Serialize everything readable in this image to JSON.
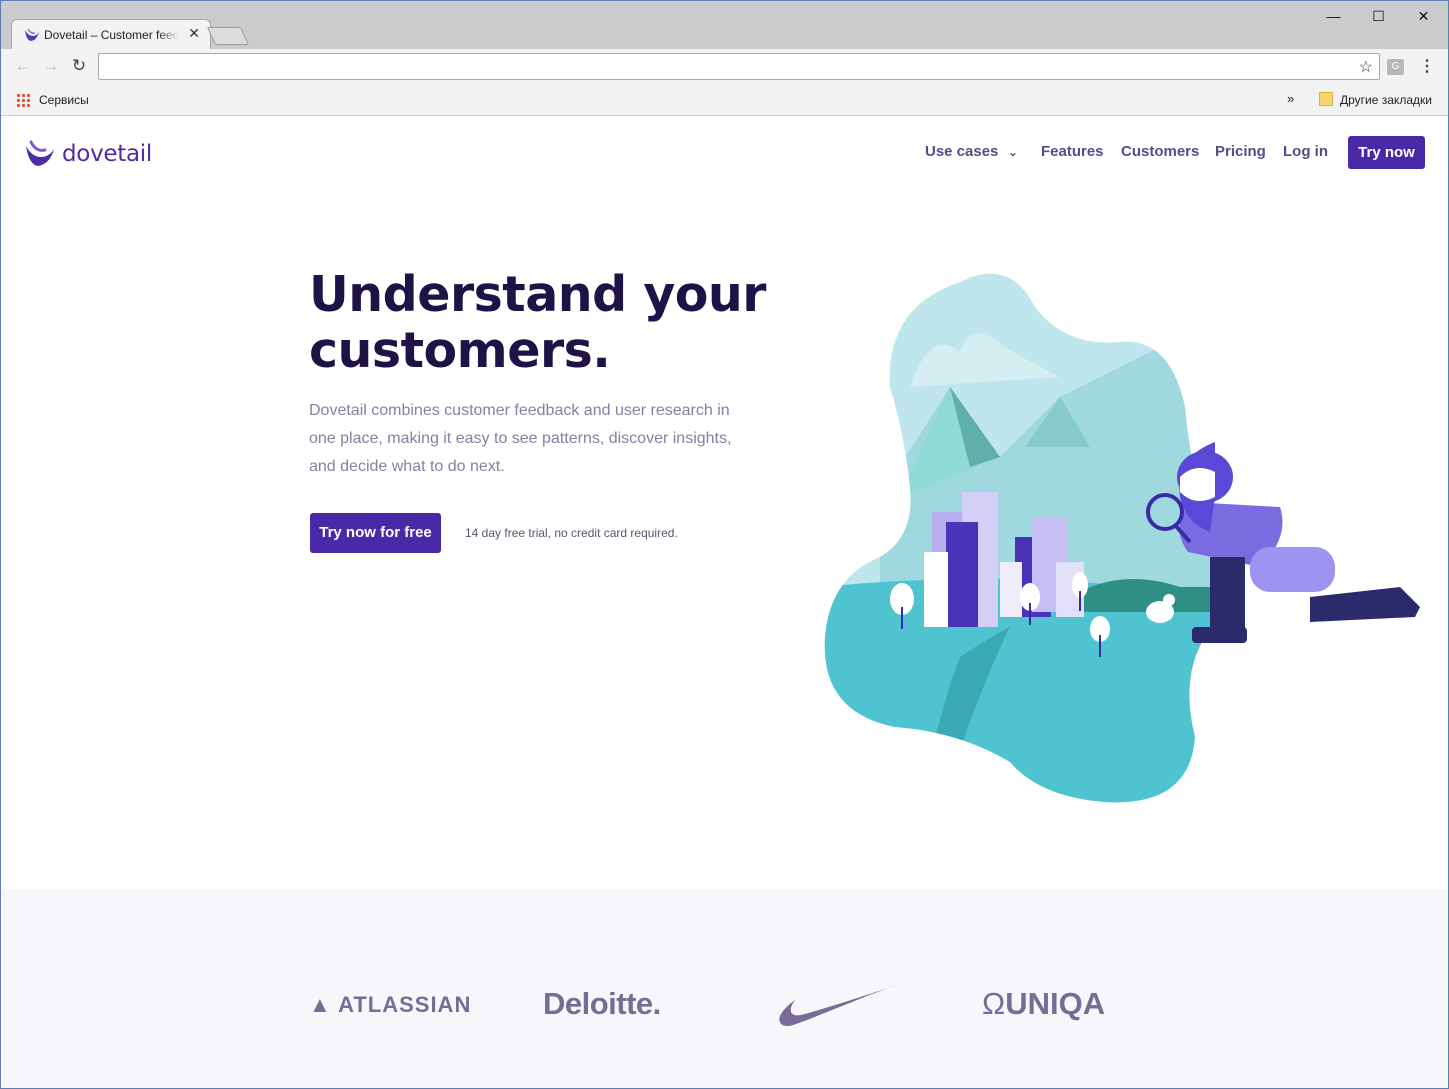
{
  "browser": {
    "tab_title": "Dovetail – Customer feedback",
    "minimize": "—",
    "maximize": "☐",
    "close": "✕",
    "tab_close": "✕",
    "bookmarks": {
      "apps_label": "Сервисы",
      "overflow": "»",
      "other_label": "Другие закладки"
    },
    "extension_label": "G"
  },
  "site": {
    "logo_text": "dovetail",
    "nav": {
      "use_cases": "Use cases",
      "features": "Features",
      "customers": "Customers",
      "pricing": "Pricing",
      "login": "Log in",
      "try_now": "Try now"
    },
    "hero": {
      "title_line1": "Understand your",
      "title_line2": "customers.",
      "subtitle": "Dovetail combines customer feedback and user research in one place, making it easy to see patterns, discover insights, and decide what to do next.",
      "cta": "Try now for free",
      "note": "14 day free trial, no credit card required."
    },
    "customer_logos": {
      "atlassian": "ATLASSIAN",
      "deloitte": "Deloitte.",
      "uniqa": "UNIQA"
    }
  },
  "colors": {
    "brand_purple": "#4a29a6",
    "heading": "#1f1246",
    "logo_gray": "#766c95",
    "teal": "#4fc3cf"
  }
}
